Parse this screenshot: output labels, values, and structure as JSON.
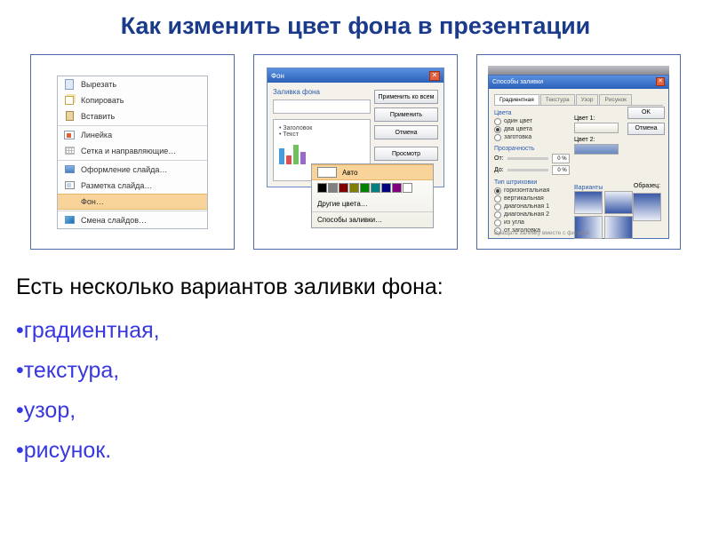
{
  "title": "Как изменить цвет фона в презентации",
  "ctx": {
    "cut": "Вырезать",
    "copy": "Копировать",
    "paste": "Вставить",
    "ruler": "Линейка",
    "grid": "Сетка и направляющие…",
    "design": "Оформление слайда…",
    "layout": "Разметка слайда…",
    "background": "Фон…",
    "transition": "Смена слайдов…"
  },
  "fillDlg": {
    "title": "Фон",
    "sectionLabel": "Заливка фона",
    "slideTitle": "• Заголовок",
    "slideText": "• Текст",
    "applyAll": "Применить ко всем",
    "apply": "Применить",
    "cancel": "Отмена",
    "preview": "Просмотр"
  },
  "drop": {
    "auto": "Авто",
    "swatches": [
      "#000",
      "#808080",
      "#800000",
      "#808000",
      "#008000",
      "#008080",
      "#000080",
      "#800080",
      "#fff"
    ],
    "more": "Другие цвета…",
    "ways": "Способы заливки…"
  },
  "waysDlg": {
    "title": "Способы заливки",
    "tabs": [
      "Градиентная",
      "Текстура",
      "Узор",
      "Рисунок"
    ],
    "grpColors": "Цвета",
    "rOne": "один цвет",
    "rTwo": "два цвета",
    "rPreset": "заготовка",
    "lColor1": "Цвет 1:",
    "lColor2": "Цвет 2:",
    "grpTrans": "Прозрачность",
    "from": "От:",
    "to": "До:",
    "pct": "0 %",
    "grpShade": "Тип штриховки",
    "shHoriz": "горизонтальная",
    "shVert": "вертикальная",
    "shD1": "диагональная 1",
    "shD2": "диагональная 2",
    "shCorner": "из угла",
    "shTitle": "от заголовка",
    "grpVar": "Варианты",
    "sample": "Образец:",
    "rotate": "Вращать заливку вместе с фигурой",
    "ok": "OK",
    "cancel": "Отмена"
  },
  "intro": "Есть несколько вариантов заливки фона:",
  "bullets": {
    "b1": "•градиентная,",
    "b2": "•текстура,",
    "b3": "•узор,",
    "b4": "•рисунок."
  }
}
